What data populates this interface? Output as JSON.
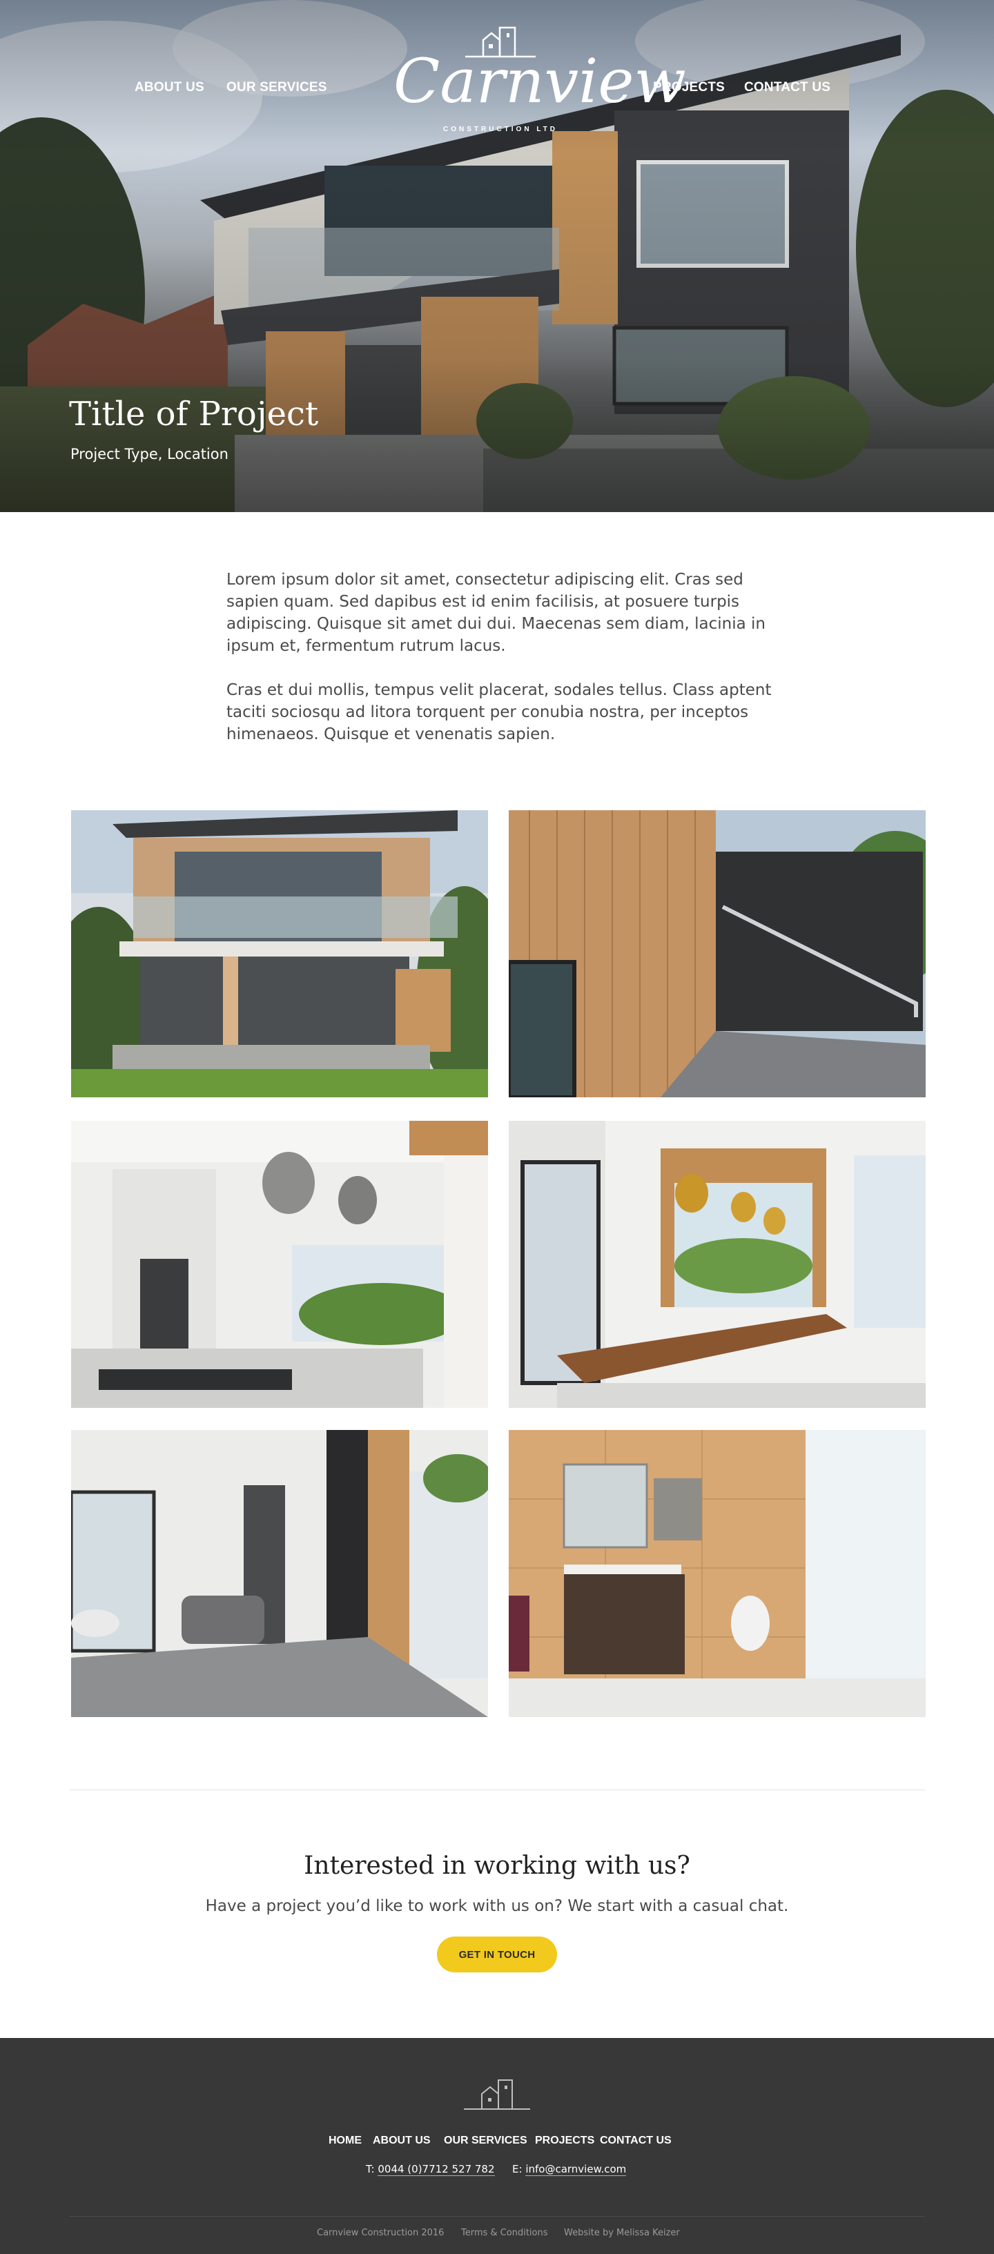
{
  "header": {
    "nav_left": [
      "ABOUT US",
      "OUR SERVICES"
    ],
    "nav_right": [
      "PROJECTS",
      "CONTACT US"
    ],
    "logo": {
      "wordmark": "Carnview",
      "tagline": "CONSTRUCTION LTD"
    }
  },
  "hero": {
    "title": "Title of Project",
    "subtitle": "Project Type, Location"
  },
  "intro": {
    "paragraph_1": "Lorem ipsum dolor sit amet, consectetur adipiscing elit. Cras sed sapien quam. Sed dapibus est id enim facilisis, at posuere turpis adipiscing. Quisque sit amet dui dui. Maecenas sem diam, lacinia in ipsum et, fermentum rutrum lacus.",
    "paragraph_2": "Cras et dui mollis, tempus velit placerat, sodales tellus. Class aptent taciti sociosqu ad litora torquent per conubia nostra, per inceptos himenaeos. Quisque et venenatis sapien."
  },
  "gallery": {
    "photos": [
      "house-exterior-photo",
      "timber-cladding-stair-photo",
      "kitchen-photo",
      "dining-room-photo",
      "living-room-photo",
      "bathroom-photo"
    ]
  },
  "cta": {
    "title": "Interested in working with us?",
    "text": "Have a project you’d like to work with us on? We start with a casual chat.",
    "button_label": "GET IN TOUCH"
  },
  "footer": {
    "nav": [
      "HOME",
      "ABOUT US",
      "OUR SERVICES",
      "PROJECTS",
      "CONTACT US"
    ],
    "phone_prefix": "T:",
    "phone": "0044 (0)7712 527 782",
    "email_prefix": "E:",
    "email": "info@carnview.com",
    "copyright": "Carnview Construction 2016",
    "terms": "Terms & Conditions",
    "credit": "Website by Melissa Keizer"
  },
  "colors": {
    "accent": "#f2c91d",
    "footer_bg": "#383838",
    "heading": "#222222",
    "body_text": "#4a4a4a"
  }
}
